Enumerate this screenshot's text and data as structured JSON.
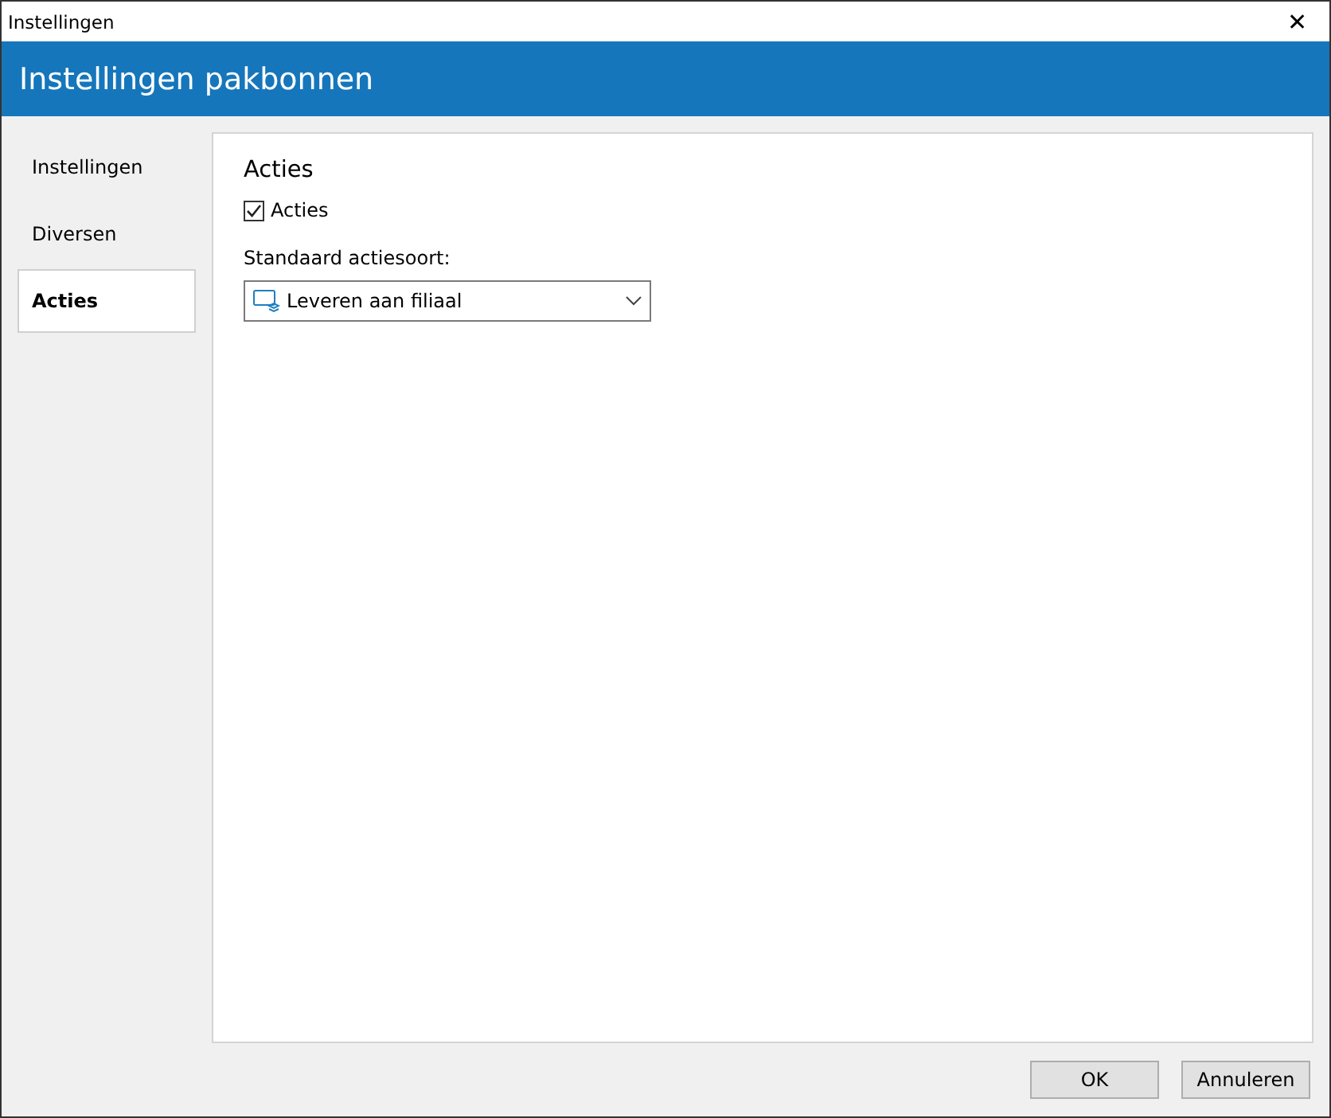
{
  "window": {
    "title": "Instellingen",
    "close": "✕"
  },
  "header": {
    "title": "Instellingen pakbonnen"
  },
  "sidebar": {
    "items": [
      {
        "label": "Instellingen",
        "selected": false
      },
      {
        "label": "Diversen",
        "selected": false
      },
      {
        "label": "Acties",
        "selected": true
      }
    ]
  },
  "panel": {
    "title": "Acties",
    "checkbox": {
      "label": "Acties",
      "checked": true
    },
    "dropdown": {
      "label": "Standaard actiesoort:",
      "value": "Leveren aan filiaal"
    }
  },
  "buttons": [
    "OK",
    "Annuleren"
  ]
}
